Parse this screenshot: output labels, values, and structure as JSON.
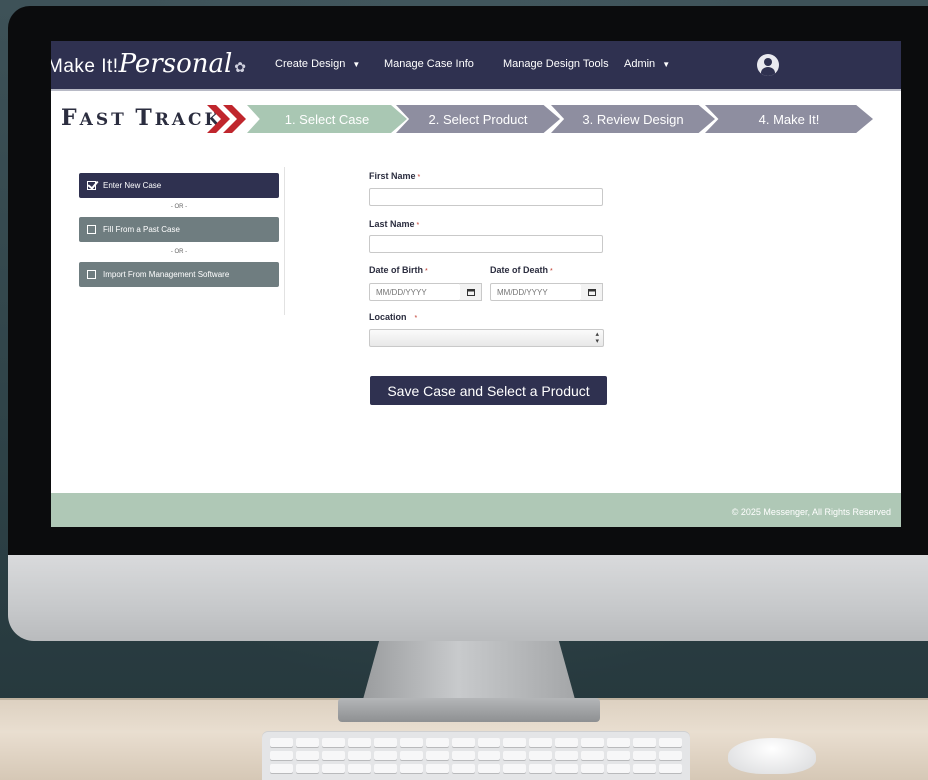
{
  "navbar": {
    "brand_prefix": "Make It!",
    "brand_script": "Personal",
    "items": [
      {
        "label": "Create Design",
        "has_caret": true
      },
      {
        "label": "Manage Case Info",
        "has_caret": false
      },
      {
        "label": "Manage Design Tools",
        "has_caret": false
      },
      {
        "label": "Admin",
        "has_caret": true
      }
    ],
    "avatar_icon": "user-avatar-icon"
  },
  "fast_track": {
    "title_big_1": "F",
    "title_small_1": "AST",
    "title_big_2": "T",
    "title_small_2": "RACK",
    "steps": [
      {
        "label": "1. Select Case",
        "active": true
      },
      {
        "label": "2. Select Product",
        "active": false
      },
      {
        "label": "3. Review Design",
        "active": false
      },
      {
        "label": "4. Make It!",
        "active": false
      }
    ]
  },
  "options": {
    "items": [
      {
        "label": "Enter New Case",
        "checked": true
      },
      {
        "label": "Fill From a Past Case",
        "checked": false
      },
      {
        "label": "Import From Management Software",
        "checked": false
      }
    ],
    "separator": "- OR -"
  },
  "form": {
    "first_name_label": "First Name",
    "last_name_label": "Last Name",
    "dob_label": "Date of Birth",
    "dod_label": "Date of Death",
    "location_label": "Location",
    "required_mark": "*",
    "date_placeholder": "MM/DD/YYYY",
    "submit_label": "Save Case and Select a Product"
  },
  "footer": {
    "copyright": "© 2025 Messenger, All Rights Reserved"
  },
  "colors": {
    "navy": "#2f3150",
    "sage": "#a9c7b3",
    "step_gray": "#8e8ea0",
    "chevron_red": "#c0262d"
  }
}
